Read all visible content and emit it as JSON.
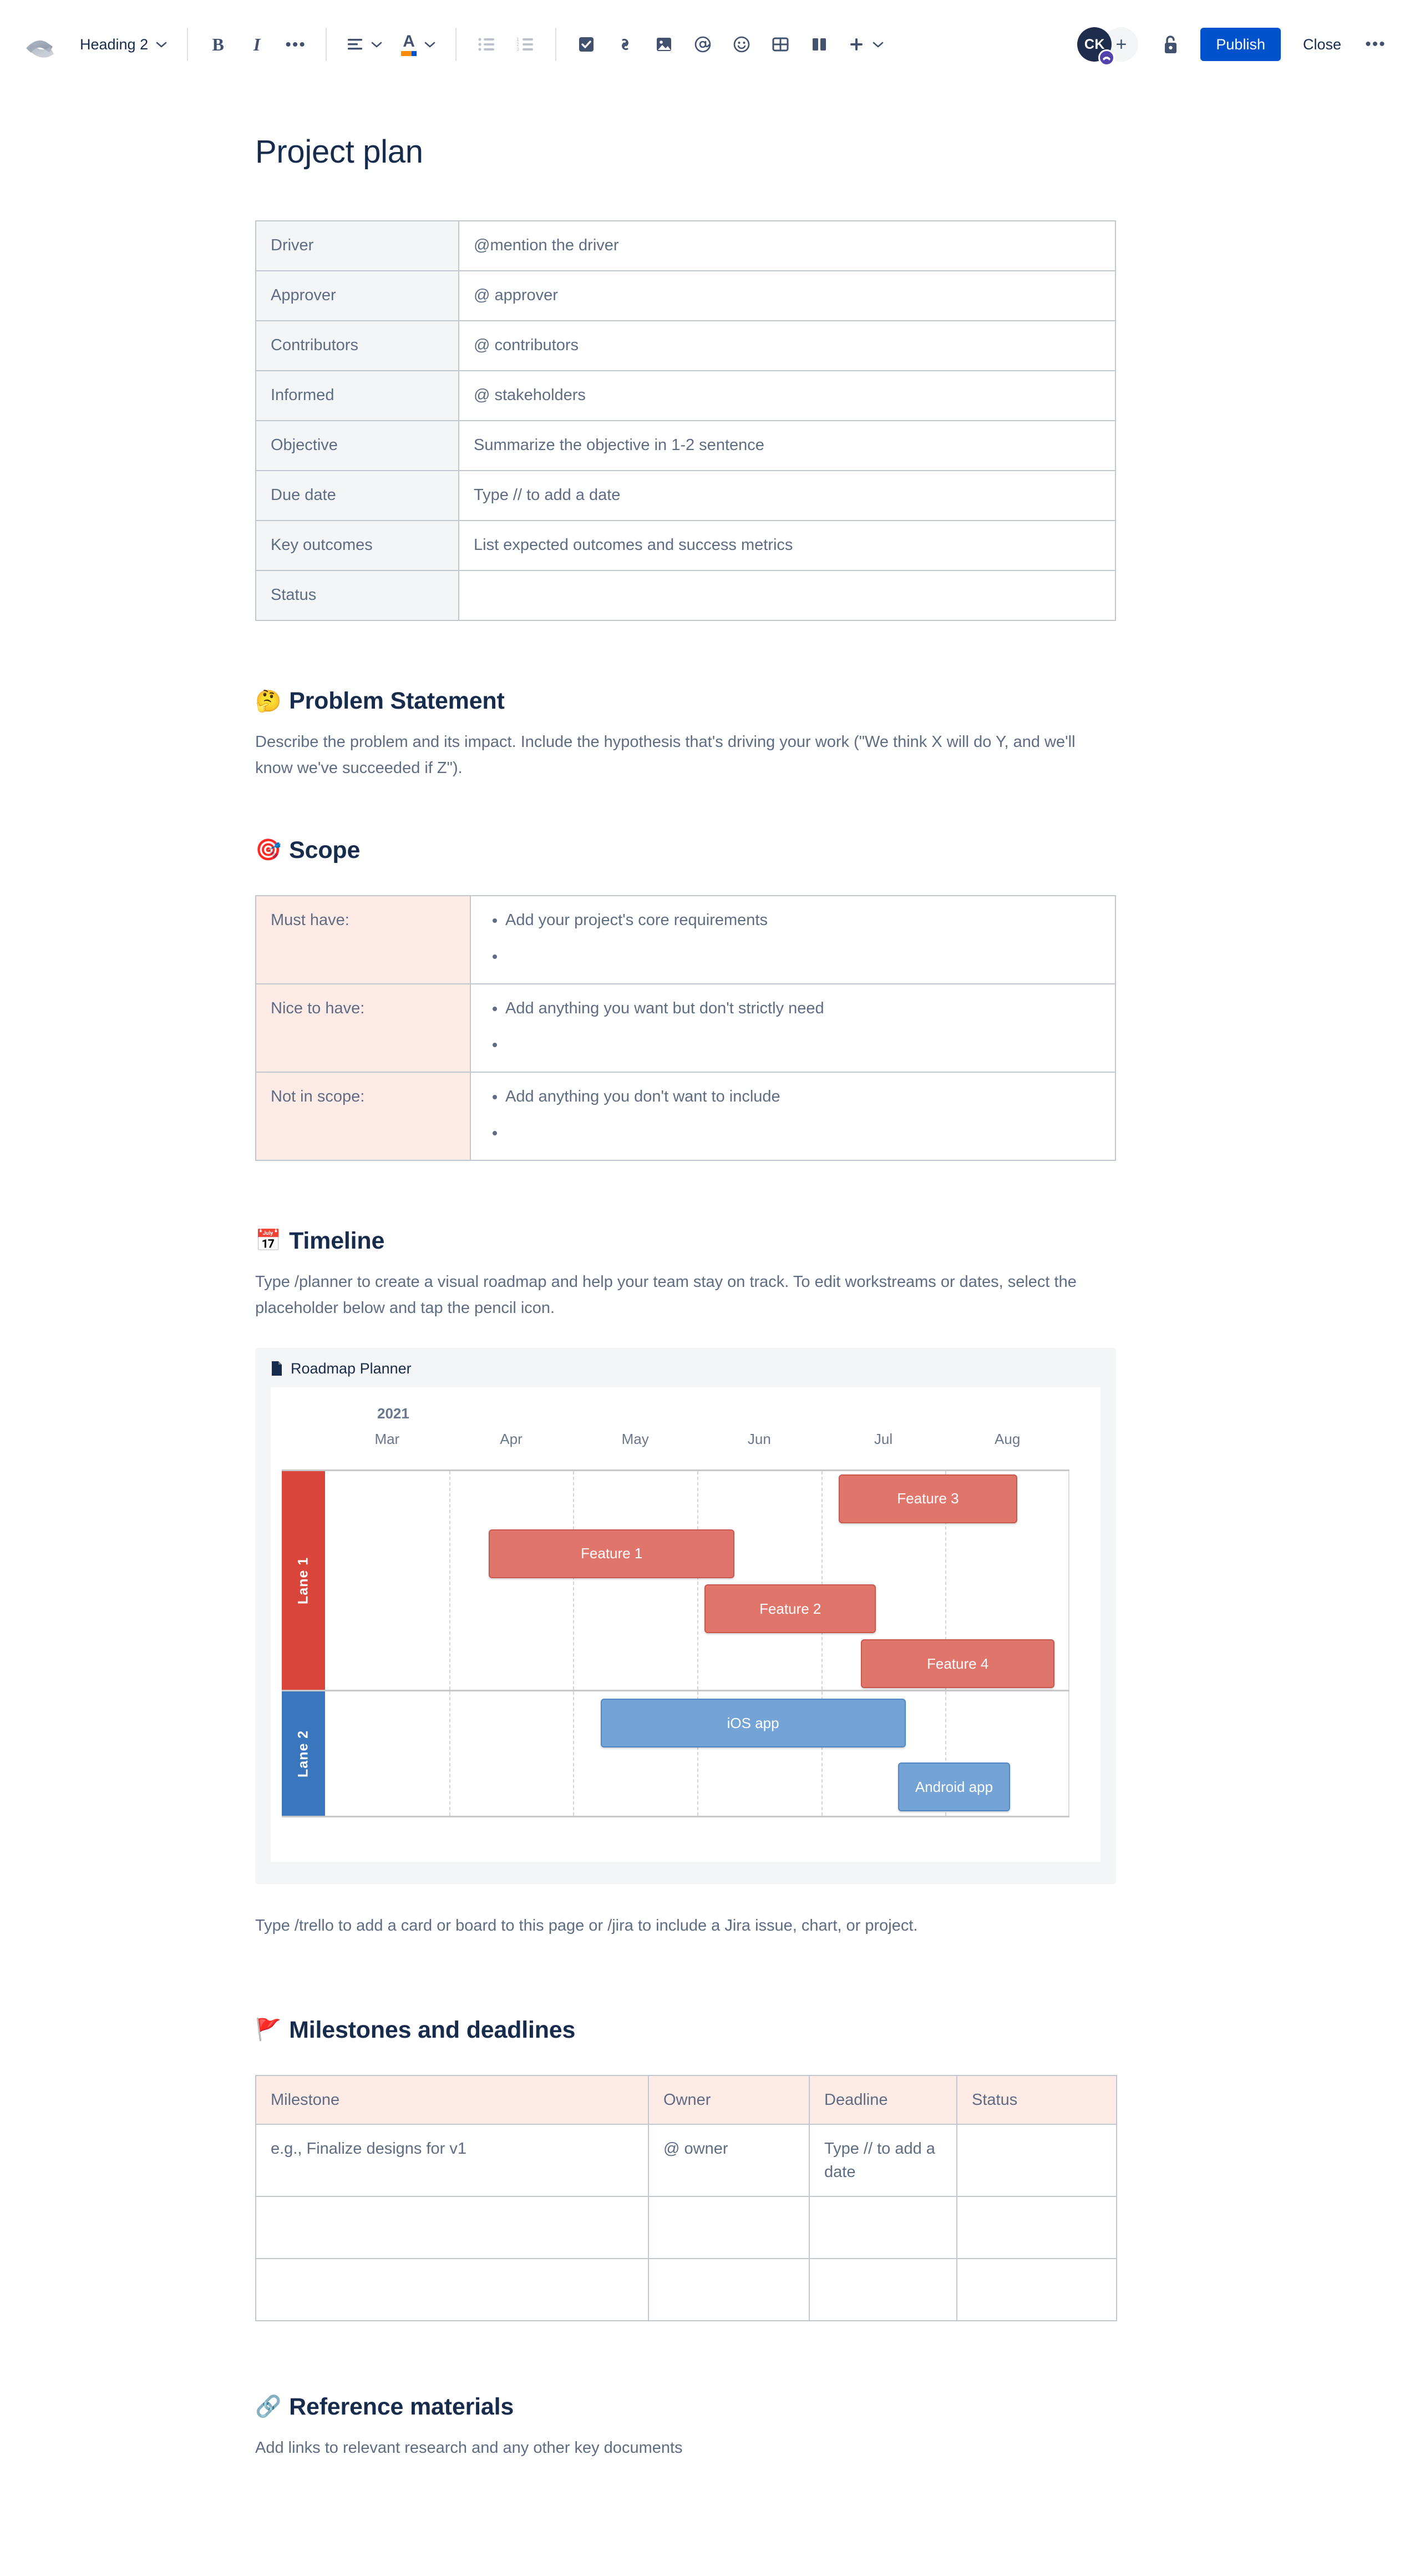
{
  "toolbar": {
    "logo_icon": "confluence-logo-icon",
    "style_select": {
      "label": "Heading 2",
      "icon": "chevron-down-icon"
    },
    "bold_label": "B",
    "italic_label": "I",
    "more_formatting_label": "•••",
    "align_icon": "text-align-icon",
    "text_color_label": "A",
    "bullet_list_icon": "bullet-list-icon",
    "numbered_list_icon": "numbered-list-icon",
    "task_icon": "task-checkbox-icon",
    "link_icon": "link-icon",
    "image_icon": "image-icon",
    "mention_label": "@",
    "emoji_icon": "emoji-smiley-icon",
    "table_icon": "table-icon",
    "layout_icon": "page-layout-icon",
    "insert_label": "+",
    "avatar_initials": "CK",
    "avatar_badge_icon": "confluence-badge-icon",
    "add_people_label": "+",
    "restrictions_icon": "unlock-padlock-icon",
    "publish_label": "Publish",
    "close_label": "Close",
    "more_label": "•••"
  },
  "document": {
    "title": "Project plan",
    "info_table": {
      "rows": [
        {
          "label": "Driver",
          "value": "@mention the driver"
        },
        {
          "label": "Approver",
          "value": "@ approver"
        },
        {
          "label": "Contributors",
          "value": "@ contributors"
        },
        {
          "label": "Informed",
          "value": "@ stakeholders"
        },
        {
          "label": "Objective",
          "value": "Summarize the objective in 1-2 sentence"
        },
        {
          "label": "Due date",
          "value": "Type // to add a date"
        },
        {
          "label": "Key outcomes",
          "value": "List expected outcomes and success metrics"
        },
        {
          "label": "Status",
          "value": ""
        }
      ]
    },
    "problem_statement": {
      "emoji": "🤔",
      "emoji_name": "thinking-face-emoji",
      "heading": "Problem Statement",
      "body": "Describe the problem and its impact. Include the hypothesis that's driving your work (\"We think X will do Y, and we'll know we've succeeded if Z\")."
    },
    "scope": {
      "emoji": "🎯",
      "emoji_name": "direct-hit-emoji",
      "heading": "Scope",
      "rows": [
        {
          "label": "Must have:",
          "items": [
            "Add your project's core requirements",
            ""
          ]
        },
        {
          "label": "Nice to have:",
          "items": [
            "Add anything you want but don't strictly need",
            ""
          ]
        },
        {
          "label": "Not in scope:",
          "items": [
            "Add anything you don't want to include",
            ""
          ]
        }
      ]
    },
    "timeline": {
      "emoji": "📅",
      "emoji_name": "calendar-emoji",
      "heading": "Timeline",
      "body": "Type /planner to create a visual roadmap and help your team stay on track. To edit workstreams or dates, select the placeholder below and tap the pencil icon.",
      "planner_title": "Roadmap Planner",
      "planner_icon": "page-icon",
      "footer_note": "Type /trello to add a card or board to this page or /jira to include a Jira issue, chart, or project."
    },
    "milestones": {
      "emoji": "🚩",
      "emoji_name": "triangular-flag-emoji",
      "heading": "Milestones and deadlines",
      "columns": [
        "Milestone",
        "Owner",
        "Deadline",
        "Status"
      ],
      "rows": [
        [
          "e.g., Finalize designs for v1",
          "@ owner",
          "Type // to add a date",
          ""
        ],
        [
          "",
          "",
          "",
          ""
        ],
        [
          "",
          "",
          "",
          ""
        ]
      ]
    },
    "reference": {
      "emoji": "🔗",
      "emoji_name": "link-emoji",
      "heading": "Reference materials",
      "body": "Add links to relevant research and any other key documents"
    }
  },
  "chart_data": {
    "type": "bar",
    "chart_kind": "gantt-roadmap",
    "title": "Roadmap Planner",
    "year": "2021",
    "categories": [
      "Mar",
      "Apr",
      "May",
      "Jun",
      "Jul",
      "Aug"
    ],
    "xlabel": "",
    "ylabel": "",
    "grid": true,
    "legend": "none",
    "colors": {
      "lane1": "#d9453a",
      "lane2": "#3a76bd",
      "bar_red": "#e0756c",
      "bar_blue": "#74a3d6"
    },
    "lanes": [
      {
        "name": "Lane 1",
        "color": "#d9453a",
        "bars": [
          {
            "label": "Feature 3",
            "start": "Jul",
            "end": "Aug",
            "start_pct": 69,
            "end_pct": 93,
            "row": 0
          },
          {
            "label": "Feature 1",
            "start": "Apr",
            "end": "Jun",
            "start_pct": 22,
            "end_pct": 55,
            "row": 1
          },
          {
            "label": "Feature 2",
            "start": "Jun",
            "end": "Jul",
            "start_pct": 51,
            "end_pct": 74,
            "row": 2
          },
          {
            "label": "Feature 4",
            "start": "Jul",
            "end": "Aug",
            "start_pct": 72,
            "end_pct": 98,
            "row": 3
          }
        ]
      },
      {
        "name": "Lane 2",
        "color": "#3a76bd",
        "bars": [
          {
            "label": "iOS app",
            "start": "May",
            "end": "Jul",
            "start_pct": 37,
            "end_pct": 78,
            "row": 0
          },
          {
            "label": "Android app",
            "start": "Jul",
            "end": "Aug",
            "start_pct": 77,
            "end_pct": 92,
            "row": 1
          }
        ]
      }
    ]
  }
}
